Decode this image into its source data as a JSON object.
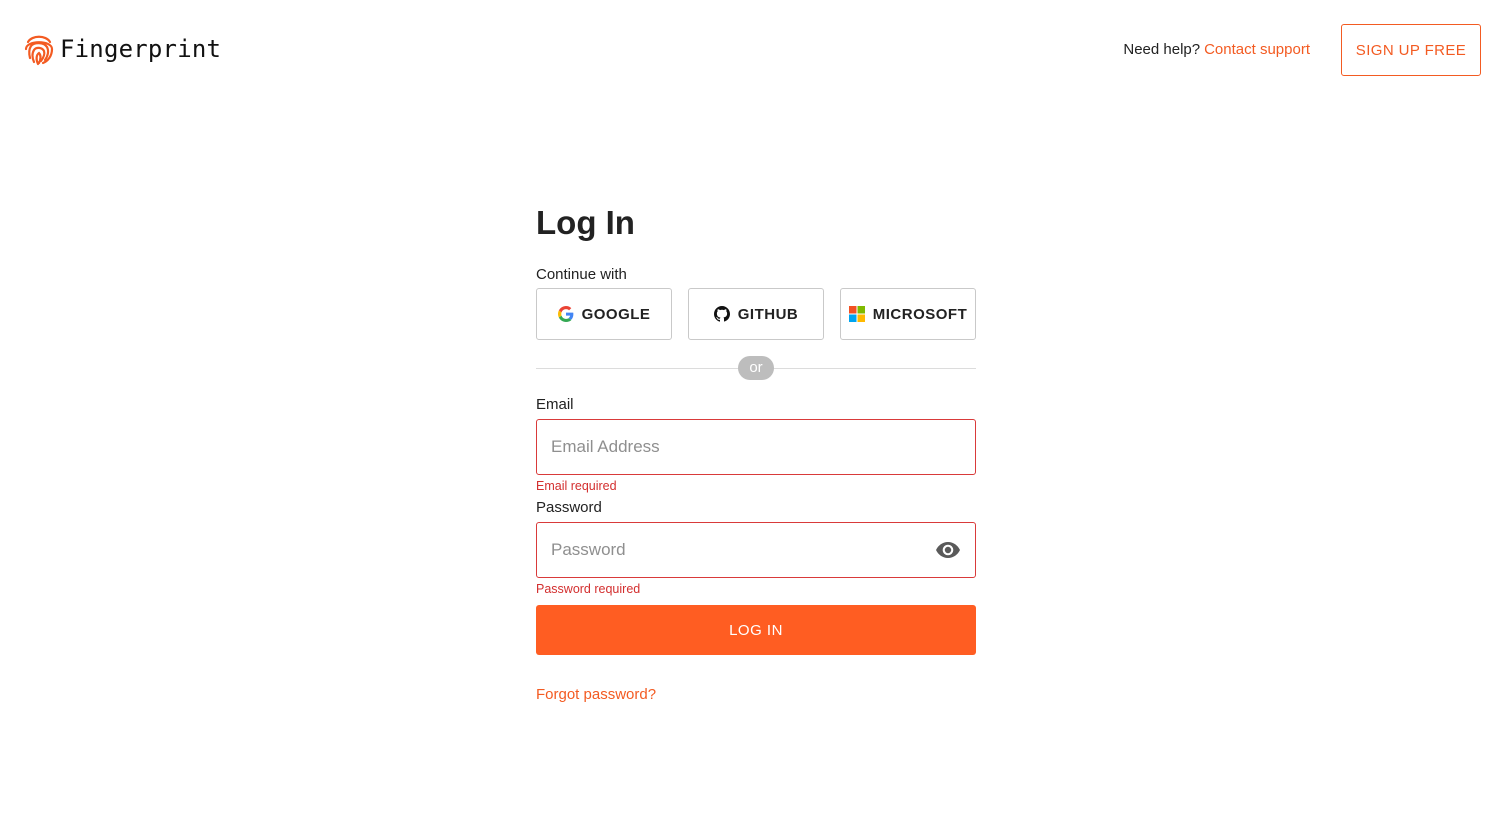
{
  "brand": {
    "name": "Fingerprint",
    "icon": "fingerprint-icon",
    "accent": "#f35b22"
  },
  "header": {
    "help_text": "Need help?",
    "support_link": "Contact support",
    "signup_button": "SIGN UP FREE"
  },
  "login": {
    "title": "Log In",
    "continue_label": "Continue with",
    "providers": [
      {
        "label": "GOOGLE",
        "icon": "google-icon"
      },
      {
        "label": "GITHUB",
        "icon": "github-icon"
      },
      {
        "label": "MICROSOFT",
        "icon": "microsoft-icon"
      }
    ],
    "divider_text": "or",
    "email": {
      "label": "Email",
      "placeholder": "Email Address",
      "value": "",
      "error": "Email required"
    },
    "password": {
      "label": "Password",
      "placeholder": "Password",
      "value": "",
      "error": "Password required",
      "toggle_icon": "eye-icon"
    },
    "submit_button": "LOG IN",
    "forgot_link": "Forgot password?"
  },
  "colors": {
    "accent": "#ff5d22",
    "error": "#d32f2f",
    "border": "#c9c9c9"
  }
}
